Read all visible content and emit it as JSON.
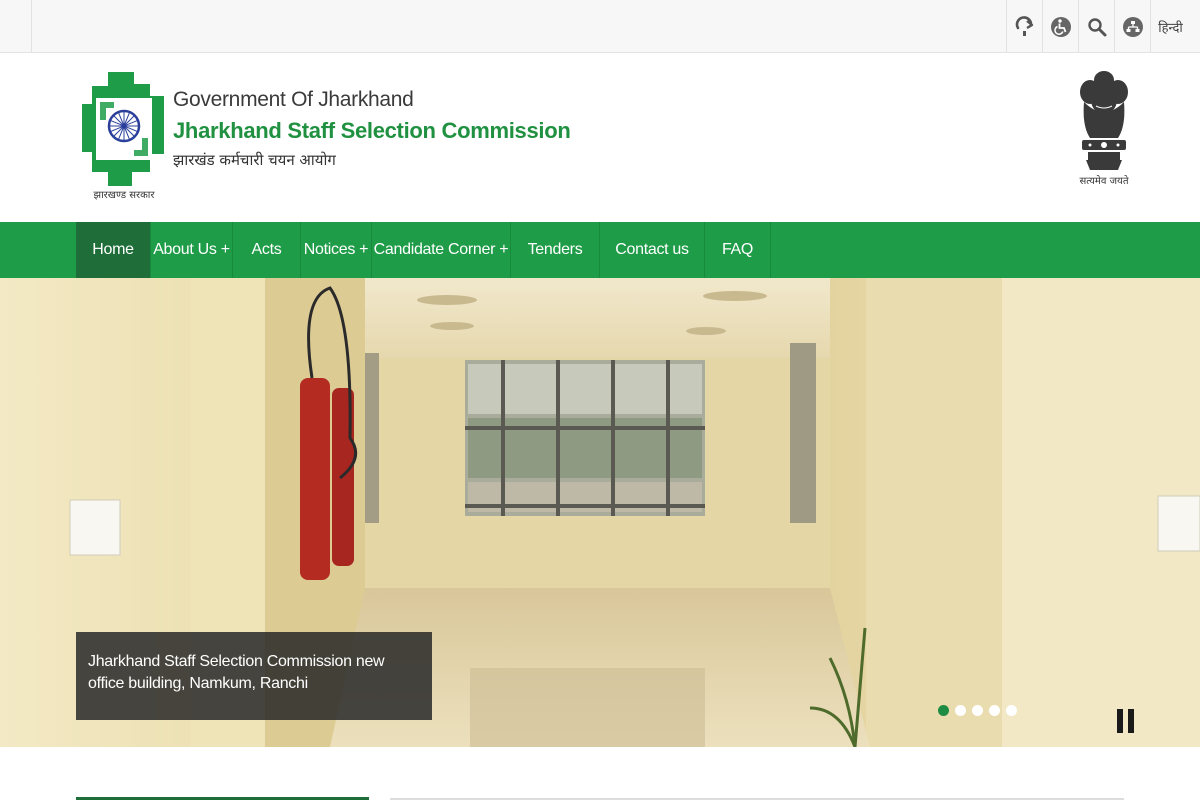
{
  "utility": {
    "language_label": "हिन्दी",
    "icons": [
      "skip-to-content-icon",
      "accessibility-icon",
      "search-icon",
      "sitemap-icon"
    ]
  },
  "header": {
    "gov_label": "Government Of Jharkhand",
    "org_name": "Jharkhand Staff Selection Commission",
    "org_name_hindi": "झारखंड कर्मचारी चयन आयोग",
    "logo_caption": "झारखण्ड सरकार",
    "emblem_caption": "सत्यमेव जयते"
  },
  "nav": {
    "items": [
      {
        "label": "Home"
      },
      {
        "label": "About Us +"
      },
      {
        "label": "Acts"
      },
      {
        "label": "Notices +"
      },
      {
        "label": "Candidate Corner +"
      },
      {
        "label": "Tenders"
      },
      {
        "label": "Contact us"
      },
      {
        "label": "FAQ"
      }
    ]
  },
  "slider": {
    "caption": "Jharkhand Staff Selection Commission new office building, Namkum, Ranchi",
    "slide_count": 5,
    "active_slide": 1
  },
  "colors": {
    "brand_green": "#1f9c48",
    "nav_active": "#1f6e3a",
    "title_green": "#1f9140"
  }
}
